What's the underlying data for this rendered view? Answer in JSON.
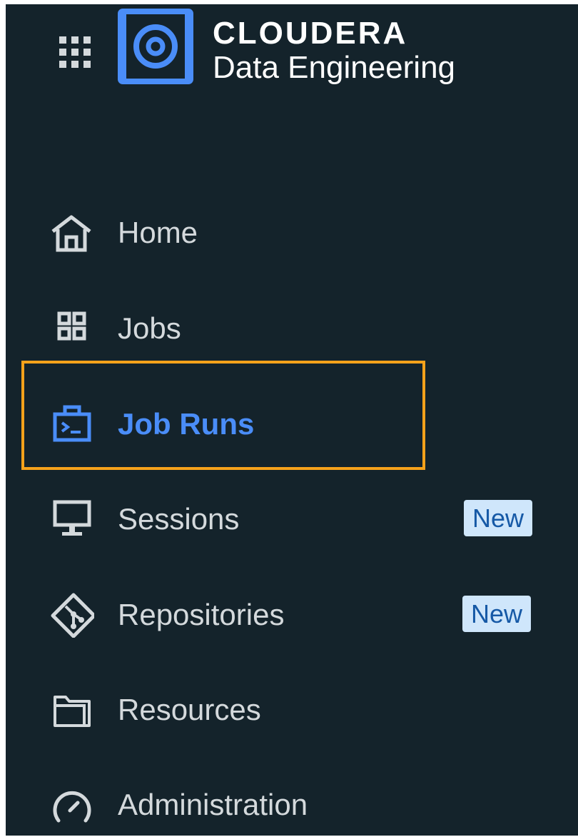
{
  "brand": {
    "company": "CLOUDERA",
    "product": "Data Engineering"
  },
  "nav": {
    "home": "Home",
    "jobs": "Jobs",
    "job_runs": "Job Runs",
    "sessions": "Sessions",
    "repositories": "Repositories",
    "resources": "Resources",
    "administration": "Administration",
    "sessions_badge": "New",
    "repositories_badge": "New",
    "active_item": "Job Runs"
  },
  "icons": {
    "apps": "grid-apps-icon",
    "logo": "cloudera-logo-icon",
    "home": "home-icon",
    "jobs": "grid-icon",
    "job_runs": "terminal-briefcase-icon",
    "sessions": "monitor-icon",
    "repositories": "git-diamond-icon",
    "resources": "folder-icon",
    "administration": "gauge-icon"
  },
  "colors": {
    "sidebar_bg": "#14232b",
    "accent": "#4a8df8",
    "highlight_border": "#f6a21b",
    "badge_bg": "#cfe6fb",
    "badge_text": "#1659a6"
  }
}
